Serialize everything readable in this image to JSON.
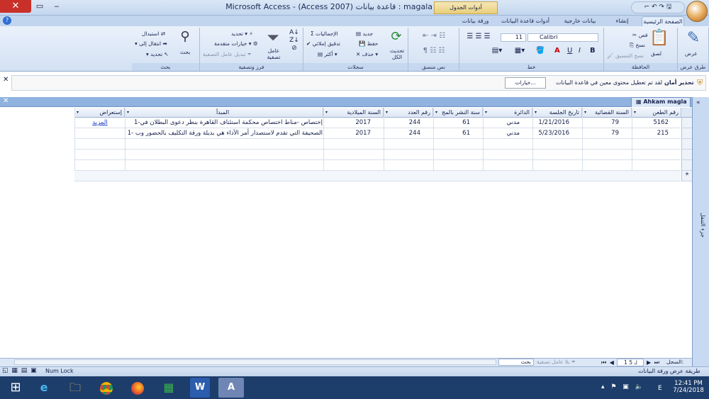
{
  "window": {
    "title": "Microsoft Access - (Access 2007) قاعدة بيانات : magala",
    "contextual_tab": "أدوات الجدول",
    "close": "✕",
    "restore": "▭",
    "minimize": "‒",
    "qat": "⌐ ↶ ↷ 🖫"
  },
  "tabs": [
    "الصفحة الرئيسية",
    "إنشاء",
    "بيانات خارجية",
    "أدوات قاعدة البيانات",
    "ورقة بيانات"
  ],
  "ribbon": {
    "views": {
      "label": "طرق عرض",
      "view": "عرض"
    },
    "clipboard": {
      "label": "الحافظة",
      "paste": "لصق",
      "cut": "قص",
      "copy": "نسخ",
      "format_painter": "نسخ التنسيق"
    },
    "font": {
      "label": "خط",
      "font_name": "Calibri",
      "font_size": "11",
      "bold": "B",
      "italic": "I",
      "underline": "U",
      "font_color": "A"
    },
    "rich_text": {
      "label": "نص منسق"
    },
    "records": {
      "label": "سجلات",
      "refresh": "تحديث الكل",
      "new": "جديد",
      "save": "حفظ",
      "delete": "حذف",
      "totals": "الإجماليات",
      "spelling": "تدقيق إملائي",
      "more": "أكثر"
    },
    "sort_filter": {
      "label": "فرز وتصفية",
      "filter": "عامل تصفية",
      "selection": "تحديد",
      "advanced": "خيارات متقدمة",
      "toggle_filter": "تبديل عامل التصفية"
    },
    "find": {
      "label": "بحث",
      "find": "بحث",
      "replace": "استبدال",
      "goto": "انتقال إلى",
      "select": "تحديد"
    }
  },
  "security": {
    "title": "تحذير أمان",
    "message": "لقد تم تعطيل محتوى معين في قاعدة البيانات",
    "options": "خيارات..."
  },
  "object_tab": "Ahkam magla",
  "nav_pane": "جزء التنقل",
  "columns": [
    "رقم الطعن",
    "السنة القضائية",
    "تاريخ الجلسة",
    "الدائرة",
    "سنة النشر بالمج",
    "رقم العدد",
    "السنة الميلادية",
    "المبدأ",
    "إستعراض"
  ],
  "rows": [
    [
      "5162",
      "79",
      "1/21/2016",
      "مدني",
      "61",
      "244",
      "2017",
      "1-إختصاص -مناط اختصاص محكمة استئناف القاهرة بنظر دعوى البطلان في",
      "المزيد"
    ],
    [
      "215",
      "79",
      "5/23/2016",
      "مدني",
      "61",
      "244",
      "2017",
      "1- الصحيفة التي تقدم لاستصدار أمر الأداء هي بديلة ورقة التكليف بالحضور وب",
      ""
    ]
  ],
  "new_row_marker": "*",
  "record_nav": {
    "label": "السجل:",
    "position": "1 لـ 5",
    "no_filter": "بلا عامل تصفية",
    "search": "بحث"
  },
  "status": {
    "view": "طريقة عرض ورقة البيانات",
    "num_lock": "Num Lock"
  },
  "taskbar": {
    "time": "12:41 PM",
    "date": "7/24/2018",
    "lang": "E"
  }
}
